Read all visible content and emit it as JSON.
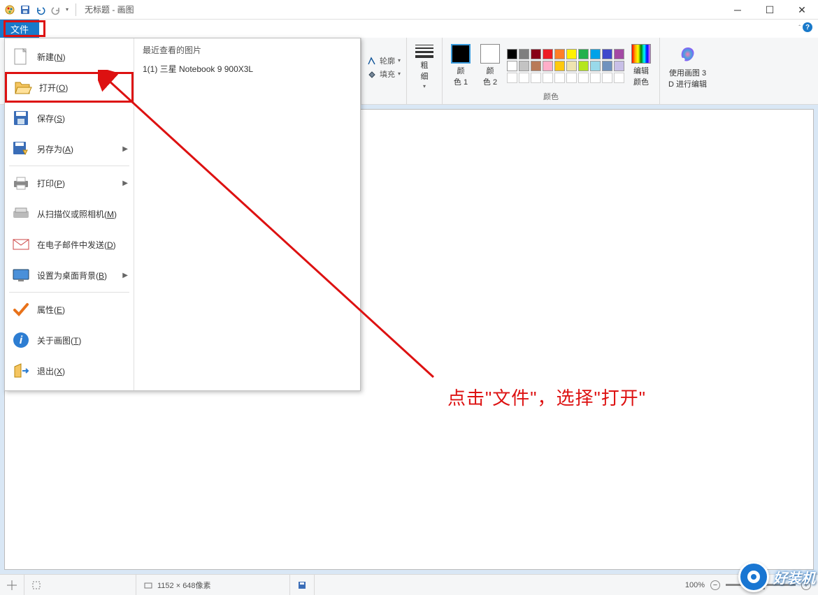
{
  "titlebar": {
    "title": "无标题 - 画图"
  },
  "tabs": {
    "file": "文件"
  },
  "ribbon": {
    "shapes": {
      "outline": "轮廓",
      "fill": "填充"
    },
    "size": {
      "label": "粗\n细"
    },
    "color1": {
      "label": "颜\n色 1"
    },
    "color2": {
      "label": "颜\n色 2"
    },
    "colors_group": "颜色",
    "editcolor": "编辑\n颜色",
    "paint3d": "使用画图 3\nD 进行编辑",
    "palette_row1": [
      "#000000",
      "#7f7f7f",
      "#880015",
      "#ed1c24",
      "#ff7f27",
      "#fff200",
      "#22b14c",
      "#00a2e8",
      "#3f48cc",
      "#a349a4"
    ],
    "palette_row2": [
      "#ffffff",
      "#c3c3c3",
      "#b97a57",
      "#ffaec9",
      "#ffc90e",
      "#efe4b0",
      "#b5e61d",
      "#99d9ea",
      "#7092be",
      "#c8bfe7"
    ]
  },
  "filemenu": {
    "recent_header": "最近查看的图片",
    "recent_items": [
      "1(1) 三星 Notebook 9 900X3L"
    ],
    "items": [
      {
        "label": "新建(N)",
        "hotkey": "N",
        "icon": "new"
      },
      {
        "label": "打开(O)",
        "hotkey": "O",
        "icon": "open",
        "highlight": true
      },
      {
        "label": "保存(S)",
        "hotkey": "S",
        "icon": "save"
      },
      {
        "label": "另存为(A)",
        "hotkey": "A",
        "icon": "saveas",
        "sub": true
      },
      {
        "label": "打印(P)",
        "hotkey": "P",
        "icon": "print",
        "sub": true
      },
      {
        "label": "从扫描仪或照相机(M)",
        "hotkey": "M",
        "icon": "scanner"
      },
      {
        "label": "在电子邮件中发送(D)",
        "hotkey": "D",
        "icon": "email"
      },
      {
        "label": "设置为桌面背景(B)",
        "hotkey": "B",
        "icon": "desktop",
        "sub": true
      },
      {
        "label": "属性(E)",
        "hotkey": "E",
        "icon": "check"
      },
      {
        "label": "关于画图(T)",
        "hotkey": "T",
        "icon": "info"
      },
      {
        "label": "退出(X)",
        "hotkey": "X",
        "icon": "exit"
      }
    ]
  },
  "annotation": {
    "text": "点击\"文件\"，选择\"打开\""
  },
  "statusbar": {
    "dims": "1152 × 648像素",
    "zoom": "100%"
  },
  "watermark": "好装机"
}
